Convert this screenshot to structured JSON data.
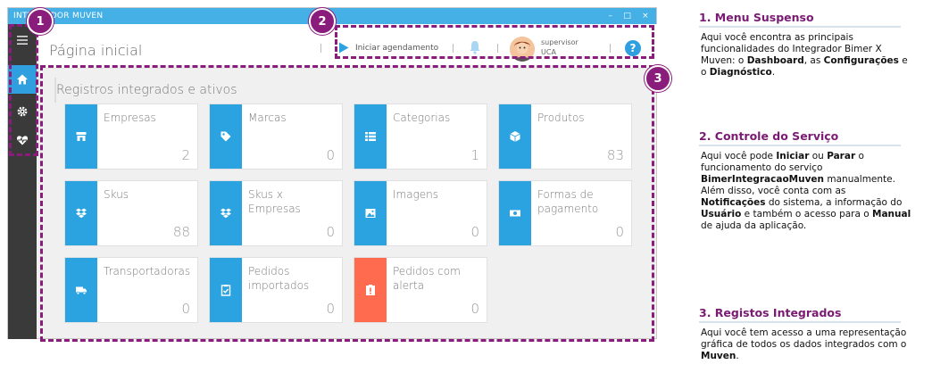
{
  "window": {
    "title": "INTEGRADOR MUVEN",
    "controls": [
      "–",
      "□",
      "×"
    ]
  },
  "sidebar": {
    "items": [
      {
        "name": "menu",
        "icon": "hamburger-icon"
      },
      {
        "name": "dashboard",
        "icon": "home-icon",
        "active": true
      },
      {
        "name": "settings",
        "icon": "gear-icon"
      },
      {
        "name": "diagnostics",
        "icon": "heart-pulse-icon"
      }
    ]
  },
  "header": {
    "page_title": "Página inicial",
    "start_label": "Iniciar agendamento",
    "user_name": "supervisor",
    "user_role": "UCA",
    "help": "?"
  },
  "section": {
    "title": "Registros integrados e ativos"
  },
  "tiles": [
    {
      "label": "Empresas",
      "value": "2",
      "icon": "store-icon"
    },
    {
      "label": "Marcas",
      "value": "0",
      "icon": "tag-icon"
    },
    {
      "label": "Categorias",
      "value": "1",
      "icon": "list-icon"
    },
    {
      "label": "Produtos",
      "value": "83",
      "icon": "box-icon"
    },
    {
      "label": "Skus",
      "value": "88",
      "icon": "dropbox-icon"
    },
    {
      "label": "Skus x Empresas",
      "value": "0",
      "icon": "dropbox-icon"
    },
    {
      "label": "Imagens",
      "value": "0",
      "icon": "image-icon"
    },
    {
      "label": "Formas de pagamento",
      "value": "0",
      "icon": "money-icon"
    },
    {
      "label": "Transportadoras",
      "value": "0",
      "icon": "truck-icon"
    },
    {
      "label": "Pedidos importados",
      "value": "0",
      "icon": "clipboard-check-icon"
    },
    {
      "label": "Pedidos com alerta",
      "value": "0",
      "icon": "alert-clipboard-icon",
      "alert": true
    }
  ],
  "badges": [
    "1",
    "2",
    "3"
  ],
  "colors": {
    "accent": "#2aa3e0",
    "alert": "#ff6b4f",
    "highlight": "#8a1d7b",
    "titlebar": "#45b0e6"
  },
  "annotations": [
    {
      "title": "1. Menu Suspenso",
      "parts": [
        {
          "t": "Aqui você encontra as principais funcionalidades do Integrador Bimer X Muven: o "
        },
        {
          "t": "Dashboard",
          "b": true
        },
        {
          "t": ", as "
        },
        {
          "t": "Configurações",
          "b": true
        },
        {
          "t": " e o "
        },
        {
          "t": "Diagnóstico",
          "b": true
        },
        {
          "t": "."
        }
      ]
    },
    {
      "title": "2. Controle do Serviço",
      "parts": [
        {
          "t": "Aqui você pode "
        },
        {
          "t": "Iniciar",
          "b": true
        },
        {
          "t": " ou "
        },
        {
          "t": "Parar",
          "b": true
        },
        {
          "t": " o funcionamento do serviço "
        },
        {
          "t": "BimerIntegracaoMuven",
          "b": true
        },
        {
          "t": " manualmente. Além disso, você conta com as "
        },
        {
          "t": "Notificações",
          "b": true
        },
        {
          "t": " do sistema, a informação do "
        },
        {
          "t": "Usuário",
          "b": true
        },
        {
          "t": " e também o acesso para o "
        },
        {
          "t": "Manual",
          "b": true
        },
        {
          "t": " de ajuda da aplicação."
        }
      ]
    },
    {
      "title": "3. Registos Integrados",
      "parts": [
        {
          "t": "Aqui você tem acesso a uma representação gráfica de todos os dados integrados com o "
        },
        {
          "t": "Muven",
          "b": true
        },
        {
          "t": "."
        }
      ]
    }
  ]
}
